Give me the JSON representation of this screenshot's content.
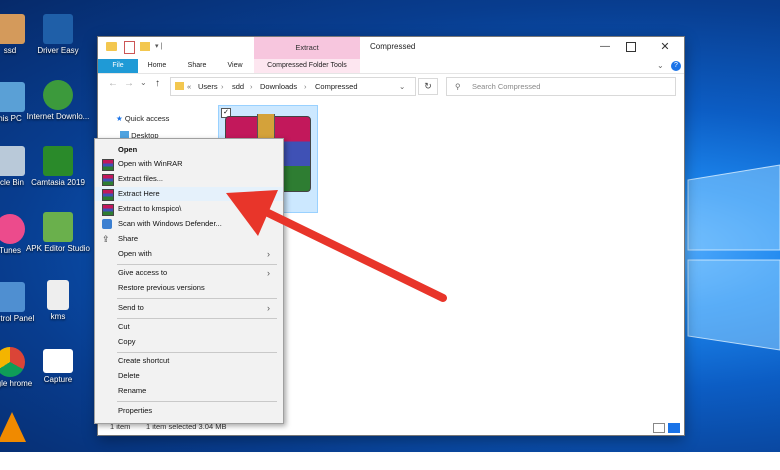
{
  "desktop": {
    "icons": [
      {
        "label": "ssd",
        "color": "#d49a5b"
      },
      {
        "label": "Driver Easy",
        "color": "#1f5fa8"
      },
      {
        "label": "his PC",
        "color": "#5aa0d6"
      },
      {
        "label": "Internet Downlo...",
        "color": "#3c9a3c"
      },
      {
        "label": "ycle Bin",
        "color": "#b9c9d9"
      },
      {
        "label": "Camtasia 2019",
        "color": "#2a8a2a"
      },
      {
        "label": "Tunes",
        "color": "#ec4b8c"
      },
      {
        "label": "APK Editor Studio",
        "color": "#6ab04c"
      },
      {
        "label": "Control Panel",
        "color": "#4f8fd1"
      },
      {
        "label": "kms",
        "color": "#eeeeee"
      },
      {
        "label": "oogle hrome",
        "color": "#db4437"
      },
      {
        "label": "Capture",
        "color": "#ffffff"
      }
    ]
  },
  "explorer": {
    "title": "Compressed",
    "contextual_tab": "Extract",
    "ribbon_tabs": [
      "File",
      "Home",
      "Share",
      "View",
      "Compressed Folder Tools"
    ],
    "path": [
      "Users",
      "sdd",
      "Downloads",
      "Compressed"
    ],
    "search_placeholder": "Search Compressed",
    "nav_items": [
      "Quick access",
      "Desktop"
    ],
    "status": {
      "items": "1 item",
      "selected": "1 item selected  3.04 MB"
    }
  },
  "context_menu": {
    "items": [
      {
        "label": "Open",
        "bold": true
      },
      {
        "label": "Open with WinRAR",
        "icon": "winrar-icon"
      },
      {
        "label": "Extract files...",
        "icon": "winrar-icon"
      },
      {
        "label": "Extract Here",
        "icon": "winrar-icon",
        "highlighted": true
      },
      {
        "label": "Extract to kmspico\\",
        "icon": "winrar-icon"
      },
      {
        "label": "Scan with Windows Defender...",
        "icon": "defender-icon"
      },
      {
        "label": "Share",
        "icon": "share-icon"
      },
      {
        "label": "Open with",
        "submenu": true
      },
      {
        "label": "Give access to",
        "submenu": true
      },
      {
        "label": "Restore previous versions"
      },
      {
        "label": "Send to",
        "submenu": true
      },
      {
        "label": "Cut"
      },
      {
        "label": "Copy"
      },
      {
        "label": "Create shortcut"
      },
      {
        "label": "Delete"
      },
      {
        "label": "Rename"
      },
      {
        "label": "Properties"
      }
    ]
  },
  "colors": {
    "arrow": "#e8352a",
    "accent": "#1a73e8",
    "file_tab": "#1f9ad6",
    "contextual": "#f7c6de"
  }
}
